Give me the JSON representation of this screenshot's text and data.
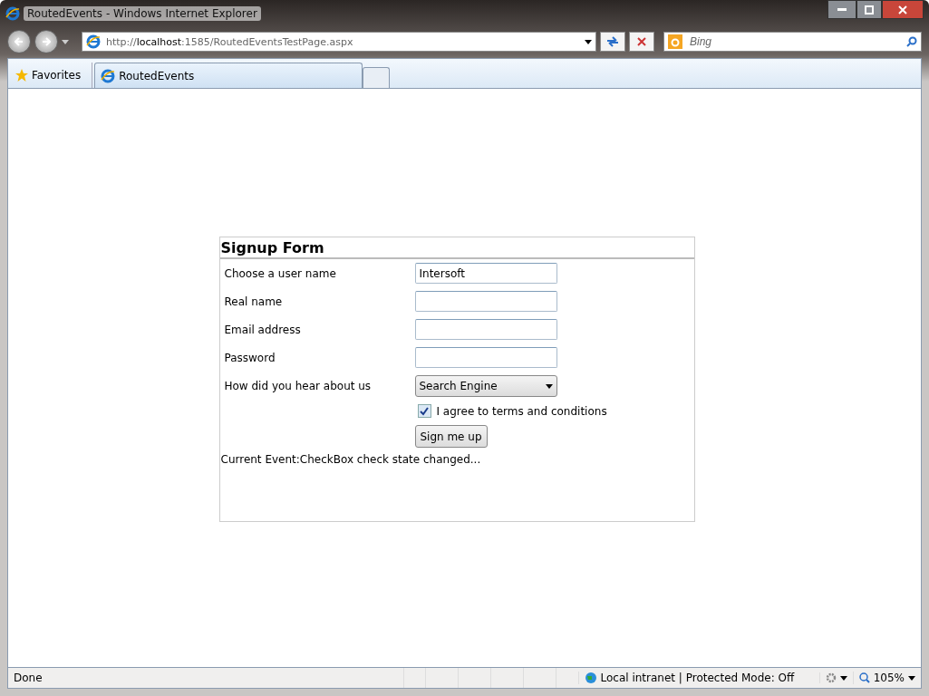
{
  "window": {
    "title": "RoutedEvents - Windows Internet Explorer"
  },
  "address_bar": {
    "url": "http://**localhost**:1585/RoutedEventsTestPage.aspx"
  },
  "search": {
    "placeholder": "Bing"
  },
  "favorites": {
    "label": "Favorites"
  },
  "tabs": [
    {
      "label": "RoutedEvents",
      "selected": true
    }
  ],
  "form": {
    "title": "Signup Form",
    "rows": [
      {
        "kind": "text",
        "label": "Choose a user name",
        "value": "Intersoft"
      },
      {
        "kind": "text",
        "label": "Real name"
      },
      {
        "kind": "text",
        "label": "Email address"
      },
      {
        "kind": "text",
        "label": "Password"
      },
      {
        "kind": "select",
        "label": "How did you hear about us",
        "value": "Search Engine"
      },
      {
        "kind": "checkbox",
        "text": "I agree to terms and conditions",
        "checked": true
      },
      {
        "kind": "button",
        "text": "Sign me up"
      }
    ],
    "event_label": "Current Event:",
    "event_text": "CheckBox check state changed..."
  },
  "status_bar": {
    "text": "Done",
    "zone": "Local intranet | Protected Mode: Off",
    "zoom": "105%"
  }
}
